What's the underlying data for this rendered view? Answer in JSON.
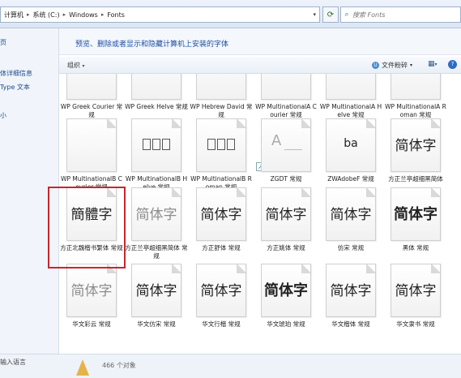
{
  "address": {
    "segments": [
      "计算机",
      "系统 (C:)",
      "Windows",
      "Fonts"
    ],
    "search_placeholder": "搜索 Fonts"
  },
  "nav": {
    "items": [
      "页",
      "体详细信息",
      "Type 文本",
      "小"
    ],
    "input_language": "输入语言"
  },
  "header": {
    "title": "预览、删除或者显示和隐藏计算机上安装的字体"
  },
  "toolbar": {
    "organize": "组织",
    "preview": "文件粉碎"
  },
  "fonts": [
    {
      "label": "WP Greek Courier 常规",
      "glyph": "",
      "style": "blank"
    },
    {
      "label": "WP Greek Helve 常规",
      "glyph": "",
      "style": "blank"
    },
    {
      "label": "WP Hebrew David 常规",
      "glyph": "",
      "style": "blank"
    },
    {
      "label": "WP MultinationalA Courier 常规",
      "glyph": "",
      "style": "blank"
    },
    {
      "label": "WP MultinationalA Helve 常规",
      "glyph": "",
      "style": "blank"
    },
    {
      "label": "WP MultinationalA Roman 常规",
      "glyph": "",
      "style": "blank"
    },
    {
      "label": "WP MultinationalB Courier 常规",
      "glyph": "",
      "style": "blank"
    },
    {
      "label": "WP MultinationalB Helve 常规",
      "glyph": "□□□",
      "style": "boxes"
    },
    {
      "label": "WP MultinationalB Roman 常规",
      "glyph": "□□□",
      "style": "boxes"
    },
    {
      "label": "ZGDT 常规",
      "glyph": "A",
      "style": "al"
    },
    {
      "label": "ZWAdobeF 常规",
      "glyph": "ba",
      "style": "sm"
    },
    {
      "label": "方正兰亭超细黑简体",
      "glyph": "简体字",
      "style": "normal"
    },
    {
      "label": "方正北魏楷书繁体 常规",
      "glyph": "簡體字",
      "style": "serif"
    },
    {
      "label": "方正兰亭超细黑简体 常规",
      "glyph": "简体字",
      "style": "light"
    },
    {
      "label": "方正舒体 常规",
      "glyph": "简体字",
      "style": "normal"
    },
    {
      "label": "方正姚体 常规",
      "glyph": "简体字",
      "style": "normal"
    },
    {
      "label": "仿宋 常规",
      "glyph": "简体字",
      "style": "normal"
    },
    {
      "label": "黑体 常规",
      "glyph": "简体字",
      "style": "bold"
    },
    {
      "label": "华文彩云 常规",
      "glyph": "简体字",
      "style": "light"
    },
    {
      "label": "华文仿宋 常规",
      "glyph": "简体字",
      "style": "normal"
    },
    {
      "label": "华文行楷 常规",
      "glyph": "简体字",
      "style": "normal"
    },
    {
      "label": "华文琥珀 常规",
      "glyph": "简体字",
      "style": "bold"
    },
    {
      "label": "华文楷体 常规",
      "glyph": "简体字",
      "style": "normal"
    },
    {
      "label": "华文隶书 常规",
      "glyph": "简体字",
      "style": "normal"
    }
  ],
  "status": {
    "count": "466 个对象"
  }
}
